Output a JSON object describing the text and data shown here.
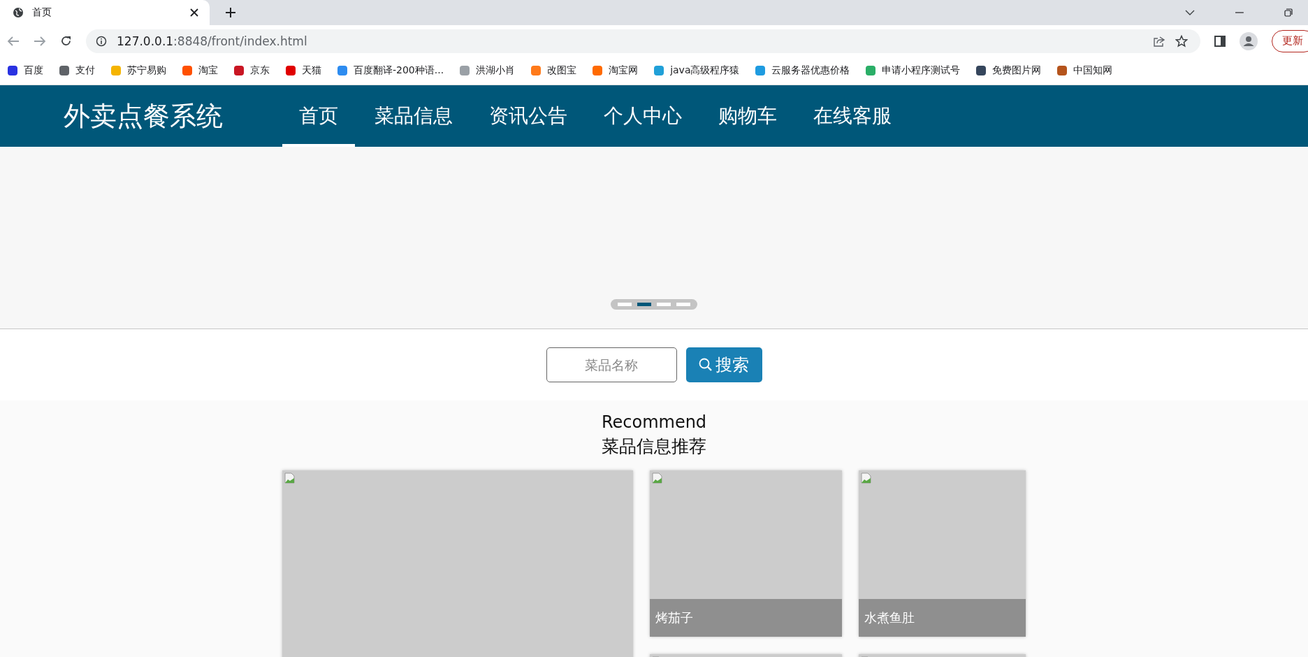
{
  "browser": {
    "tab_title": "首页",
    "url_host": "127.0.0.1",
    "url_path": ":8848/front/index.html",
    "update_button": "更新",
    "bookmarks": [
      {
        "label": "百度",
        "color": "#2932e1"
      },
      {
        "label": "支付",
        "color": "#5f6368"
      },
      {
        "label": "苏宁易购",
        "color": "#f5b400"
      },
      {
        "label": "淘宝",
        "color": "#ff5000"
      },
      {
        "label": "京东",
        "color": "#c91623"
      },
      {
        "label": "天猫",
        "color": "#e00000"
      },
      {
        "label": "百度翻译-200种语...",
        "color": "#2d8cf0"
      },
      {
        "label": "洪湖小肖",
        "color": "#9aa0a6"
      },
      {
        "label": "改图宝",
        "color": "#ff7a1a"
      },
      {
        "label": "淘宝网",
        "color": "#ff6a00"
      },
      {
        "label": "java高级程序猿",
        "color": "#20a0d8"
      },
      {
        "label": "云服务器优惠价格",
        "color": "#1e9be0"
      },
      {
        "label": "申请小程序测试号",
        "color": "#2aae67"
      },
      {
        "label": "免费图片网",
        "color": "#35465c"
      },
      {
        "label": "中国知网",
        "color": "#b5541c"
      }
    ]
  },
  "header": {
    "title": "外卖点餐系统",
    "nav": [
      {
        "label": "首页",
        "selected": true
      },
      {
        "label": "菜品信息",
        "selected": false
      },
      {
        "label": "资讯公告",
        "selected": false
      },
      {
        "label": "个人中心",
        "selected": false
      },
      {
        "label": "购物车",
        "selected": false
      },
      {
        "label": "在线客服",
        "selected": false
      }
    ]
  },
  "carousel": {
    "dots": [
      {
        "selected": false
      },
      {
        "selected": true
      },
      {
        "selected": false
      },
      {
        "selected": false
      }
    ]
  },
  "search": {
    "placeholder": "菜品名称",
    "button": "搜索"
  },
  "recommend": {
    "title_en": "Recommend",
    "title": "菜品信息推荐",
    "dishes": [
      {
        "kind": "large"
      },
      {
        "kind": "small",
        "name": "烤茄子"
      },
      {
        "kind": "small",
        "name": "水煮鱼肚"
      },
      {
        "kind": "small"
      },
      {
        "kind": "small"
      }
    ]
  }
}
